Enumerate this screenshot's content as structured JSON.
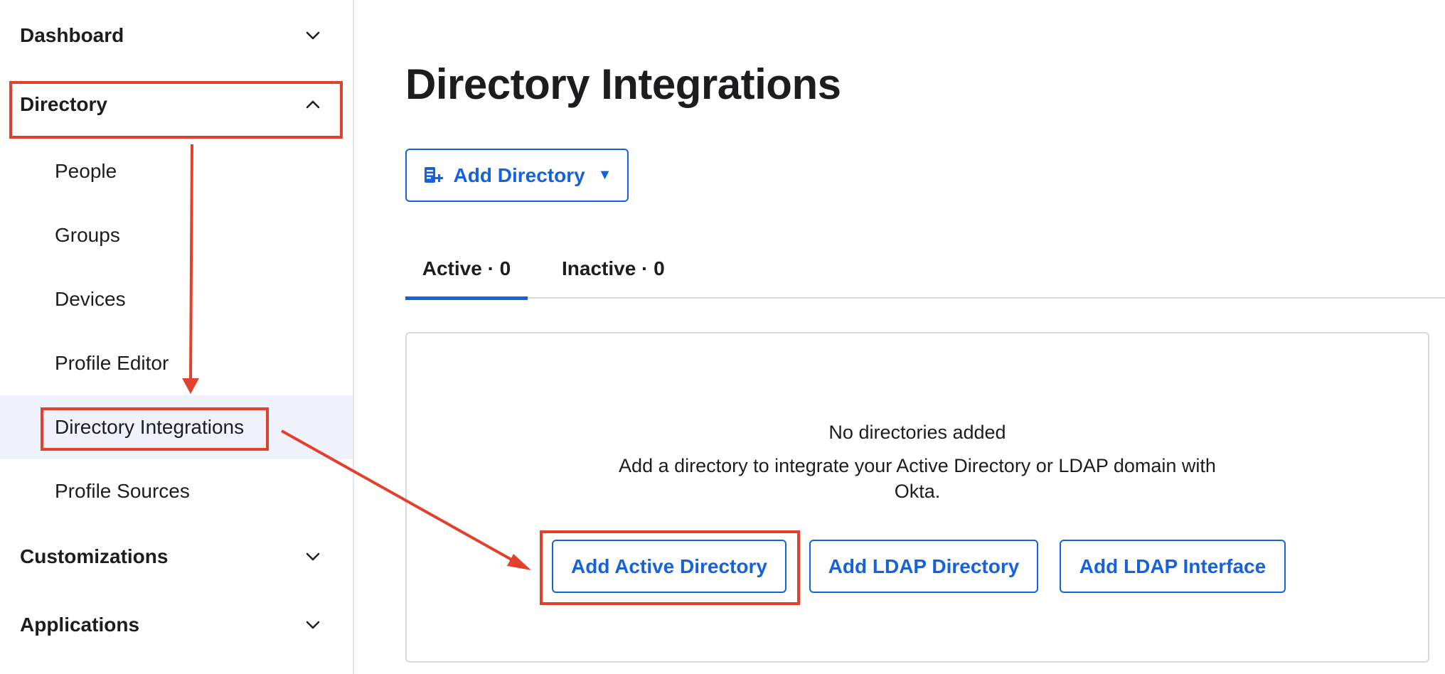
{
  "sidebar": {
    "sections": [
      {
        "label": "Dashboard",
        "expanded": false,
        "chevron_icon": "chevron-down-icon"
      },
      {
        "label": "Directory",
        "expanded": true,
        "chevron_icon": "chevron-up-icon"
      },
      {
        "label": "Customizations",
        "expanded": false,
        "chevron_icon": "chevron-down-icon"
      },
      {
        "label": "Applications",
        "expanded": false,
        "chevron_icon": "chevron-down-icon"
      }
    ],
    "directory_items": [
      {
        "label": "People"
      },
      {
        "label": "Groups"
      },
      {
        "label": "Devices"
      },
      {
        "label": "Profile Editor"
      },
      {
        "label": "Directory Integrations",
        "active": true
      },
      {
        "label": "Profile Sources"
      }
    ]
  },
  "main": {
    "title": "Directory Integrations",
    "add_directory_button": {
      "label": "Add Directory",
      "icon": "add-directory-icon",
      "caret": "▼"
    },
    "tabs": [
      {
        "label": "Active · 0",
        "active": true
      },
      {
        "label": "Inactive · 0",
        "active": false
      }
    ],
    "empty_state": {
      "title": "No directories added",
      "description": "Add a directory to integrate your Active Directory or LDAP domain with Okta.",
      "buttons": [
        {
          "label": "Add Active Directory"
        },
        {
          "label": "Add LDAP Directory"
        },
        {
          "label": "Add LDAP Interface"
        }
      ]
    }
  },
  "colors": {
    "accent": "#1662dd",
    "annotation": "#e2402c",
    "active_nav_bg": "#f0f2fb",
    "text": "#1d1d21",
    "border": "#d7d8dd"
  }
}
